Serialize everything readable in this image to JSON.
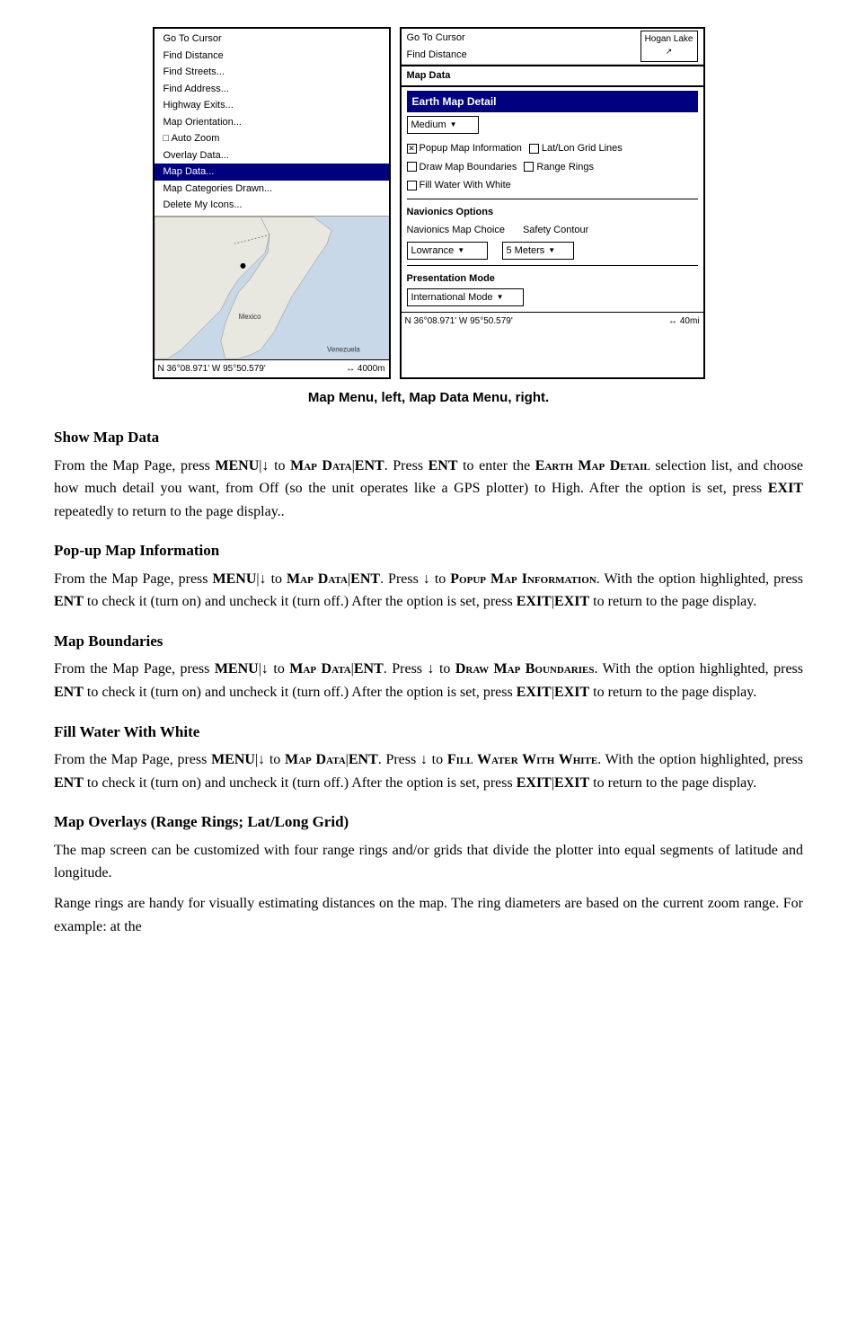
{
  "screenshot": {
    "left_panel": {
      "menu_items": [
        {
          "label": "Go To Cursor",
          "highlighted": false
        },
        {
          "label": "Find Distance",
          "highlighted": false
        },
        {
          "label": "Find Streets...",
          "highlighted": false
        },
        {
          "label": "Find Address...",
          "highlighted": false
        },
        {
          "label": "Highway Exits...",
          "highlighted": false
        },
        {
          "label": "Map Orientation...",
          "highlighted": false
        },
        {
          "label": "□ Auto Zoom",
          "highlighted": false
        },
        {
          "label": "Overlay Data...",
          "highlighted": false
        },
        {
          "label": "Map Data...",
          "highlighted": true
        },
        {
          "label": "Map Categories Drawn...",
          "highlighted": false
        },
        {
          "label": "Delete My Icons...",
          "highlighted": false
        }
      ],
      "status": "N  36°08.971'  W  95°50.579'",
      "zoom": "↔ 4000m"
    },
    "right_panel": {
      "top_bar_left": "Go To Cursor",
      "top_bar_find": "Find Distance",
      "hogan_lake_label": "Hogan Lake",
      "map_data_header": "Map Data",
      "earth_map_detail_label": "Earth Map Detail",
      "detail_value": "Medium",
      "checkboxes": [
        {
          "label": "Popup Map Information",
          "checked": true
        },
        {
          "label": "Lat/Lon Grid Lines",
          "checked": false
        },
        {
          "label": "Draw Map Boundaries",
          "checked": false
        },
        {
          "label": "Range Rings",
          "checked": false
        },
        {
          "label": "Fill Water With White",
          "checked": false
        }
      ],
      "navionics_options_label": "Navionics Options",
      "navionics_map_choice_label": "Navionics Map Choice",
      "safety_contour_label": "Safety Contour",
      "nav_choice_value": "Lowrance",
      "safety_value": "5 Meters",
      "presentation_mode_label": "Presentation Mode",
      "presentation_value": "International Mode",
      "status": "N  36°08.971'  W  95°50.579'",
      "zoom_right": "↔  40mi"
    }
  },
  "caption": "Map Menu, left, Map Data Menu, right.",
  "sections": [
    {
      "id": "show-map-data",
      "title": "Show Map Data",
      "paragraphs": [
        "From the Map Page, press MENU|↓ to MAP DATA|ENT. Press ENT to enter the EARTH MAP DETAIL selection list, and choose how much detail you want, from Off (so the unit operates like a GPS plotter) to High. After the option is set, press EXIT repeatedly to return to the page display.."
      ]
    },
    {
      "id": "popup-map-information",
      "title": "Pop-up Map Information",
      "paragraphs": [
        "From the Map Page, press MENU|↓ to MAP DATA|ENT. Press ↓ to POPUP MAP INFORMATION. With the option highlighted, press ENT to check it (turn on) and uncheck it (turn off.) After the option is set, press EXIT|EXIT to return to the page display."
      ]
    },
    {
      "id": "map-boundaries",
      "title": "Map Boundaries",
      "paragraphs": [
        "From the Map Page, press MENU|↓ to MAP DATA|ENT. Press ↓ to DRAW MAP BOUNDARIES. With the option highlighted, press ENT to check it (turn on) and uncheck it (turn off.) After the option is set, press EXIT|EXIT to return to the page display."
      ]
    },
    {
      "id": "fill-water-white",
      "title": "Fill Water With White",
      "paragraphs": [
        "From the Map Page, press MENU|↓ to MAP DATA|ENT. Press ↓ to FILL WATER WITH WHITE. With the option highlighted, press ENT to check it (turn on) and uncheck it (turn off.) After the option is set, press EXIT|EXIT to return to the page display."
      ]
    },
    {
      "id": "map-overlays",
      "title": "Map Overlays (Range Rings; Lat/Long Grid)",
      "paragraphs": [
        "The map screen can be customized with four range rings and/or grids that divide the plotter into equal segments of latitude and longitude.",
        "Range rings are handy for visually estimating distances on the map. The ring diameters are based on the current zoom range. For example: at the"
      ]
    }
  ]
}
